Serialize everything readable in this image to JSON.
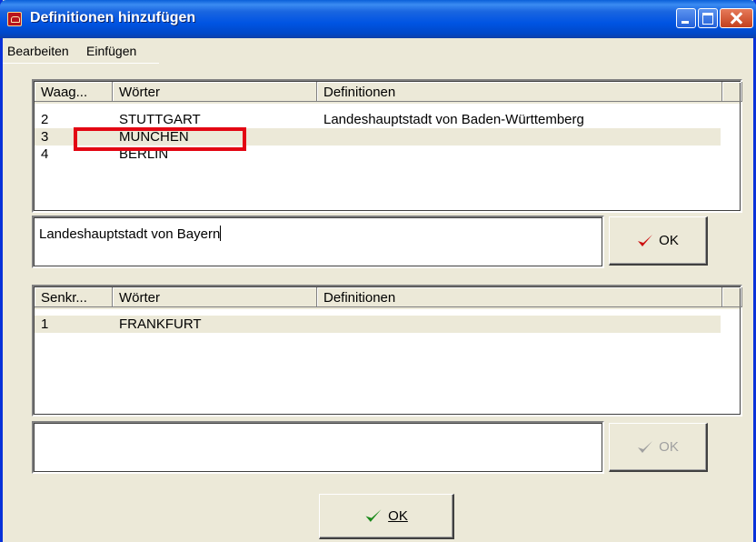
{
  "window": {
    "title": "Definitionen hinzufügen"
  },
  "menu": {
    "items": [
      "Bearbeiten",
      "Einfügen"
    ]
  },
  "across": {
    "columns": [
      "Waag...",
      "Wörter",
      "Definitionen"
    ],
    "rows": [
      {
        "num": "2",
        "word": "STUTTGART",
        "definition": "Landeshauptstadt von Baden-Württemberg"
      },
      {
        "num": "3",
        "word": "MÜNCHEN",
        "definition": ""
      },
      {
        "num": "4",
        "word": "BERLIN",
        "definition": ""
      }
    ],
    "edit_value": "Landeshauptstadt von Bayern",
    "ok_label": "OK"
  },
  "down": {
    "columns": [
      "Senkr...",
      "Wörter",
      "Definitionen"
    ],
    "rows": [
      {
        "num": "1",
        "word": "FRANKFURT",
        "definition": ""
      }
    ],
    "edit_value": "",
    "ok_label": "OK"
  },
  "main_ok_label": "OK",
  "colors": {
    "check_red": "#cc1010",
    "check_green": "#1a8a1a",
    "check_disabled": "#a0a0a0",
    "highlight_box": "#e30613"
  }
}
